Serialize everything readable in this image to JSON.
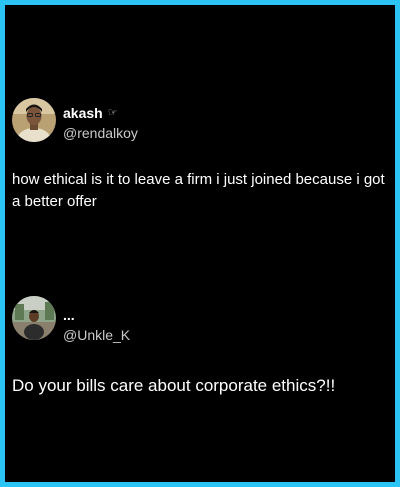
{
  "colors": {
    "frame_border": "#2cc4f4",
    "background": "#000000",
    "text_primary": "#ffffff",
    "text_secondary": "#c9c9c9"
  },
  "tweets": [
    {
      "author": {
        "display_name": "akash",
        "name_icon": "pointing-hand-icon",
        "handle": "@rendalkoy"
      },
      "text": "how ethical is it to leave a firm i just joined because i got a better offer"
    },
    {
      "author": {
        "display_name": "...",
        "handle": "@Unkle_K"
      },
      "text": "Do your bills care about corporate ethics?!!"
    }
  ]
}
